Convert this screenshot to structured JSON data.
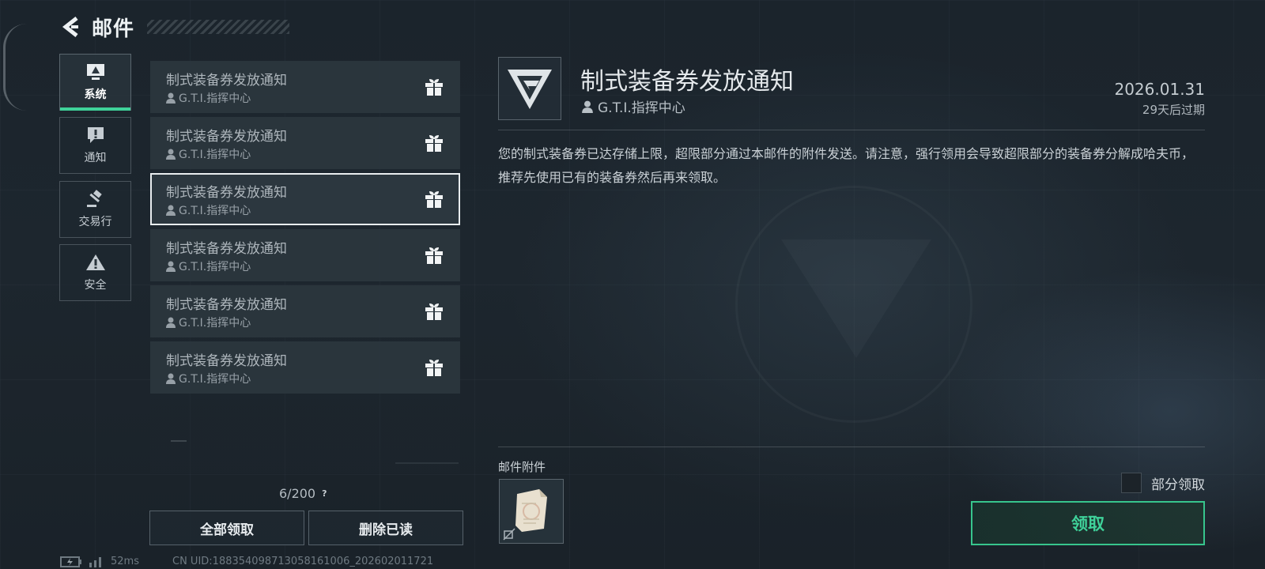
{
  "header": {
    "title": "邮件"
  },
  "categories": [
    {
      "label": "系统",
      "icon": "monitor-alert-icon",
      "active": true
    },
    {
      "label": "通知",
      "icon": "exclamation-icon",
      "active": false
    },
    {
      "label": "交易行",
      "icon": "gavel-icon",
      "active": false
    },
    {
      "label": "安全",
      "icon": "warning-triangle-icon",
      "active": false
    }
  ],
  "mails": [
    {
      "subject": "制式装备券发放通知",
      "sender": "G.T.I.指挥中心"
    },
    {
      "subject": "制式装备券发放通知",
      "sender": "G.T.I.指挥中心"
    },
    {
      "subject": "制式装备券发放通知",
      "sender": "G.T.I.指挥中心"
    },
    {
      "subject": "制式装备券发放通知",
      "sender": "G.T.I.指挥中心"
    },
    {
      "subject": "制式装备券发放通知",
      "sender": "G.T.I.指挥中心"
    },
    {
      "subject": "制式装备券发放通知",
      "sender": "G.T.I.指挥中心"
    }
  ],
  "list_footer": {
    "count": "6/200",
    "help": "?"
  },
  "buttons": {
    "claim_all": "全部领取",
    "delete_read": "删除已读"
  },
  "status": {
    "ping": "52ms",
    "uid": "CN UID:188354098713058161006_202602011721"
  },
  "detail": {
    "title": "制式装备券发放通知",
    "sender": "G.T.I.指挥中心",
    "date": "2026.01.31",
    "expire": "29天后过期",
    "body": "您的制式装备券已达存储上限，超限部分通过本邮件的附件发送。请注意，强行领用会导致超限部分的装备券分解成哈夫币，推荐先使用已有的装备券然后再来领取。",
    "attachments_title": "邮件附件",
    "attachment_icon": "document-voucher-icon",
    "partial_claim": "部分领取",
    "claim": "领取"
  },
  "colors": {
    "accent": "#3fd29a",
    "selected_border": "#e9edef"
  }
}
